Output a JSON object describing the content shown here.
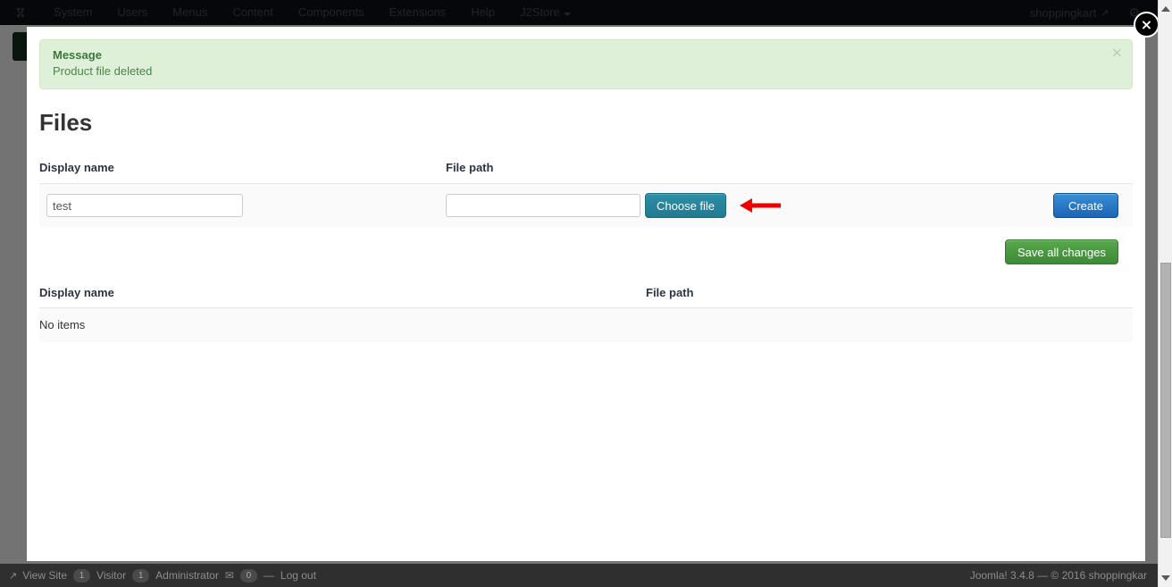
{
  "admin_bar": {
    "logo_icon": "joomla-logo-icon",
    "menu": [
      {
        "label": "System"
      },
      {
        "label": "Users"
      },
      {
        "label": "Menus"
      },
      {
        "label": "Content"
      },
      {
        "label": "Components"
      },
      {
        "label": "Extensions"
      },
      {
        "label": "Help"
      },
      {
        "label": "J2Store",
        "has_caret": true
      }
    ],
    "user": {
      "label": "shoppingkart",
      "icon": "external-link-icon"
    },
    "settings_icon": "gear-icon"
  },
  "modal": {
    "close_icon": "close-circle-icon",
    "alert": {
      "title": "Message",
      "body": "Product file deleted",
      "close_icon": "close-icon",
      "bg_color": "#dff0d8",
      "text_color": "#468847"
    },
    "page_title": "Files",
    "form": {
      "display_name_label": "Display name",
      "file_path_label": "File path",
      "display_name_value": "test",
      "display_name_placeholder": "",
      "file_path_value": "",
      "file_path_placeholder": "",
      "choose_file_label": "Choose file",
      "create_label": "Create",
      "annotation_icon": "left-arrow-annotation",
      "annotation_color": "#ee0000"
    },
    "save_all_label": "Save all changes",
    "table": {
      "columns": [
        "Display name",
        "File path"
      ],
      "rows": [],
      "empty_label": "No items"
    }
  },
  "footer": {
    "view_site_icon": "external-link-icon",
    "view_site_label": "View Site",
    "visitor_count": "1",
    "visitor_label": "Visitor",
    "admin_count": "1",
    "admin_label": "Administrator",
    "messages_icon": "envelope-icon",
    "messages_count": "0",
    "separator": "—",
    "logout_label": "Log out",
    "copyright": "Joomla! 3.4.8  —  © 2016 shoppingkar"
  },
  "scrollbar": {
    "up_icon": "scroll-up-arrow-icon",
    "down_icon": "scroll-down-arrow-icon"
  }
}
